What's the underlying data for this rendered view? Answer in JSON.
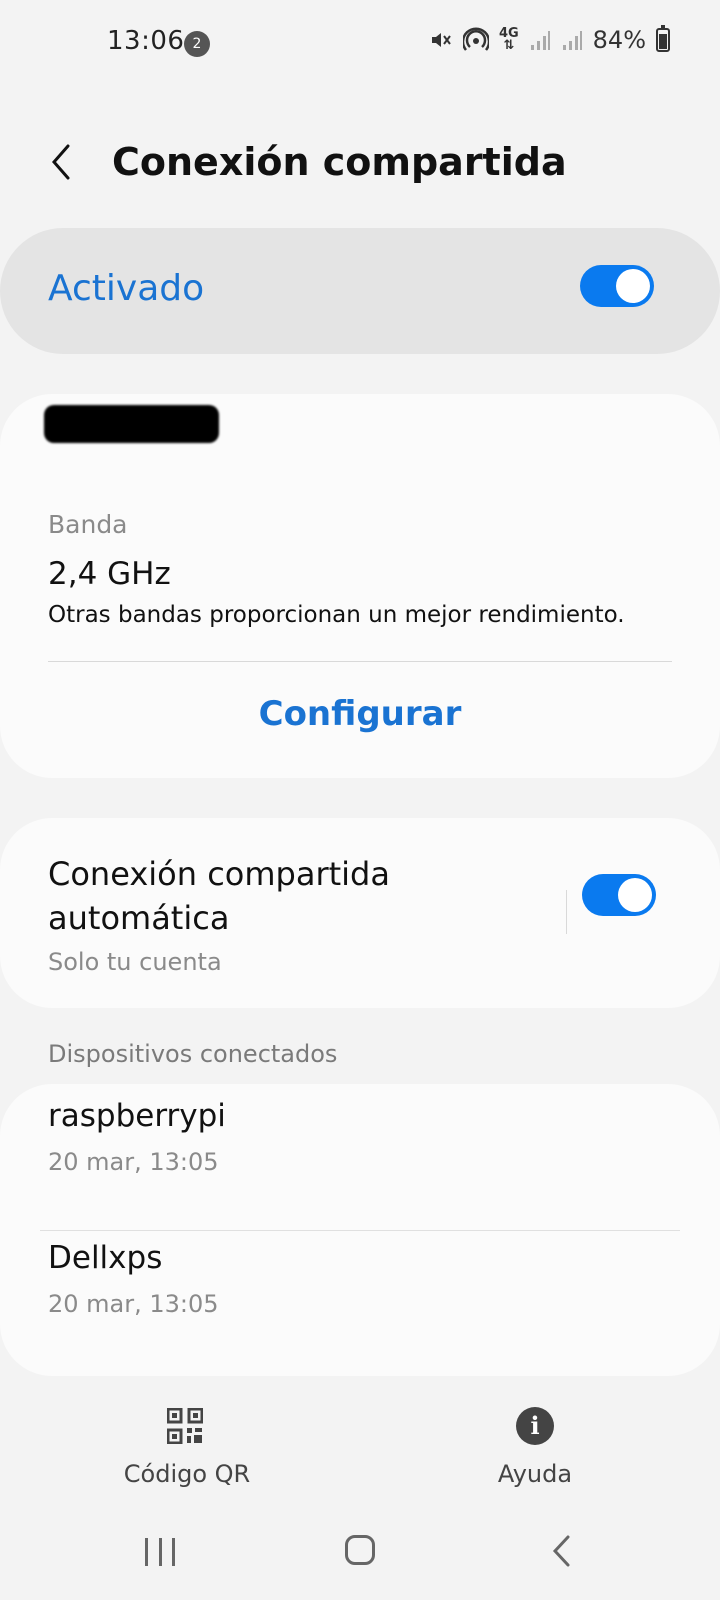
{
  "status_bar": {
    "time": "13:06",
    "notification_count": "2",
    "network_type": "4G",
    "battery": "84%"
  },
  "header": {
    "title": "Conexión compartida"
  },
  "master_switch": {
    "label": "Activado",
    "state": "on"
  },
  "network": {
    "band_label": "Banda",
    "band_value": "2,4 GHz",
    "band_description": "Otras bandas proporcionan un mejor rendimiento.",
    "configure_label": "Configurar"
  },
  "auto_hotspot": {
    "title": "Conexión compartida automática",
    "subtitle": "Solo tu cuenta",
    "state": "on"
  },
  "connected_devices": {
    "header": "Dispositivos conectados",
    "items": [
      {
        "name": "raspberrypi",
        "time": "20 mar, 13:05"
      },
      {
        "name": "Dellxps",
        "time": "20 mar, 13:05"
      }
    ]
  },
  "bottom_actions": {
    "qr_label": "Código QR",
    "help_label": "Ayuda"
  },
  "colors": {
    "accent": "#1a73d2",
    "toggle_on": "#0a7aef",
    "background": "#f3f3f3",
    "card": "#fbfbfb"
  }
}
